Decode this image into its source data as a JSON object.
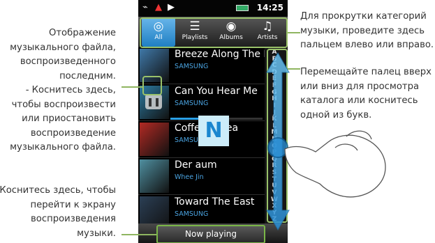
{
  "callouts": {
    "last_played": [
      "Отображение",
      "музыкального файла,",
      "воспроизведенного",
      "последним.",
      "- Коснитесь здесь,",
      "чтобы воспроизвести",
      "или приостановить",
      "воспроизведение",
      "музыкального файла."
    ],
    "now_playing": [
      "Коснитесь здесь, чтобы",
      "перейти к экрану",
      "воспроизведения",
      "музыки."
    ],
    "scroll_categories": [
      "Для прокрутки категорий",
      "музыки, проведите здесь",
      "пальцем влево или вправо."
    ],
    "index_scroll": [
      "Перемещайте палец вверх",
      "или вниз для просмотра",
      "каталога или коснитесь",
      "одной из букв."
    ]
  },
  "status_bar": {
    "time": "14:25",
    "icons": [
      "usb-icon",
      "warning-icon",
      "play-icon",
      "battery-icon"
    ]
  },
  "tabs": [
    {
      "label": "All",
      "icon": "disc-icon",
      "active": true
    },
    {
      "label": "Playlists",
      "icon": "playlist-icon",
      "active": false
    },
    {
      "label": "Albums",
      "icon": "album-icon",
      "active": false
    },
    {
      "label": "Artists",
      "icon": "artist-icon",
      "active": false
    }
  ],
  "songs": [
    {
      "title": "Breeze Along The Rive",
      "artist": "SAMSUNG",
      "art_color": "#3f78a8"
    },
    {
      "title": "Can You Hear Me",
      "artist": "SAMSUNG",
      "art_color": "#2c7aa0",
      "progress": 0.45
    },
    {
      "title": "Coffee or tea",
      "artist": "SAMSUNG",
      "art_color": "#b22a24"
    },
    {
      "title": "Der       aum",
      "artist": "Whee Jin",
      "art_color": "#4f8fa0"
    },
    {
      "title": "Toward The East",
      "artist": "SAMSUNG",
      "art_color": "#2b3f55"
    }
  ],
  "index_letters": [
    "A",
    "B",
    "C",
    "D",
    "E",
    "F",
    "G",
    "H",
    "I",
    "J",
    "K",
    "L",
    "M",
    "N",
    "O",
    "P",
    "Q",
    "R",
    "S",
    "T",
    "U",
    "V",
    "W",
    "X",
    "Y",
    "Z"
  ],
  "popup_letter": "N",
  "now_playing_label": "Now playing",
  "colors": {
    "accent_blue": "#2a9fe6",
    "callout_green": "#8fb560",
    "artist_blue": "#4aa3e0"
  }
}
